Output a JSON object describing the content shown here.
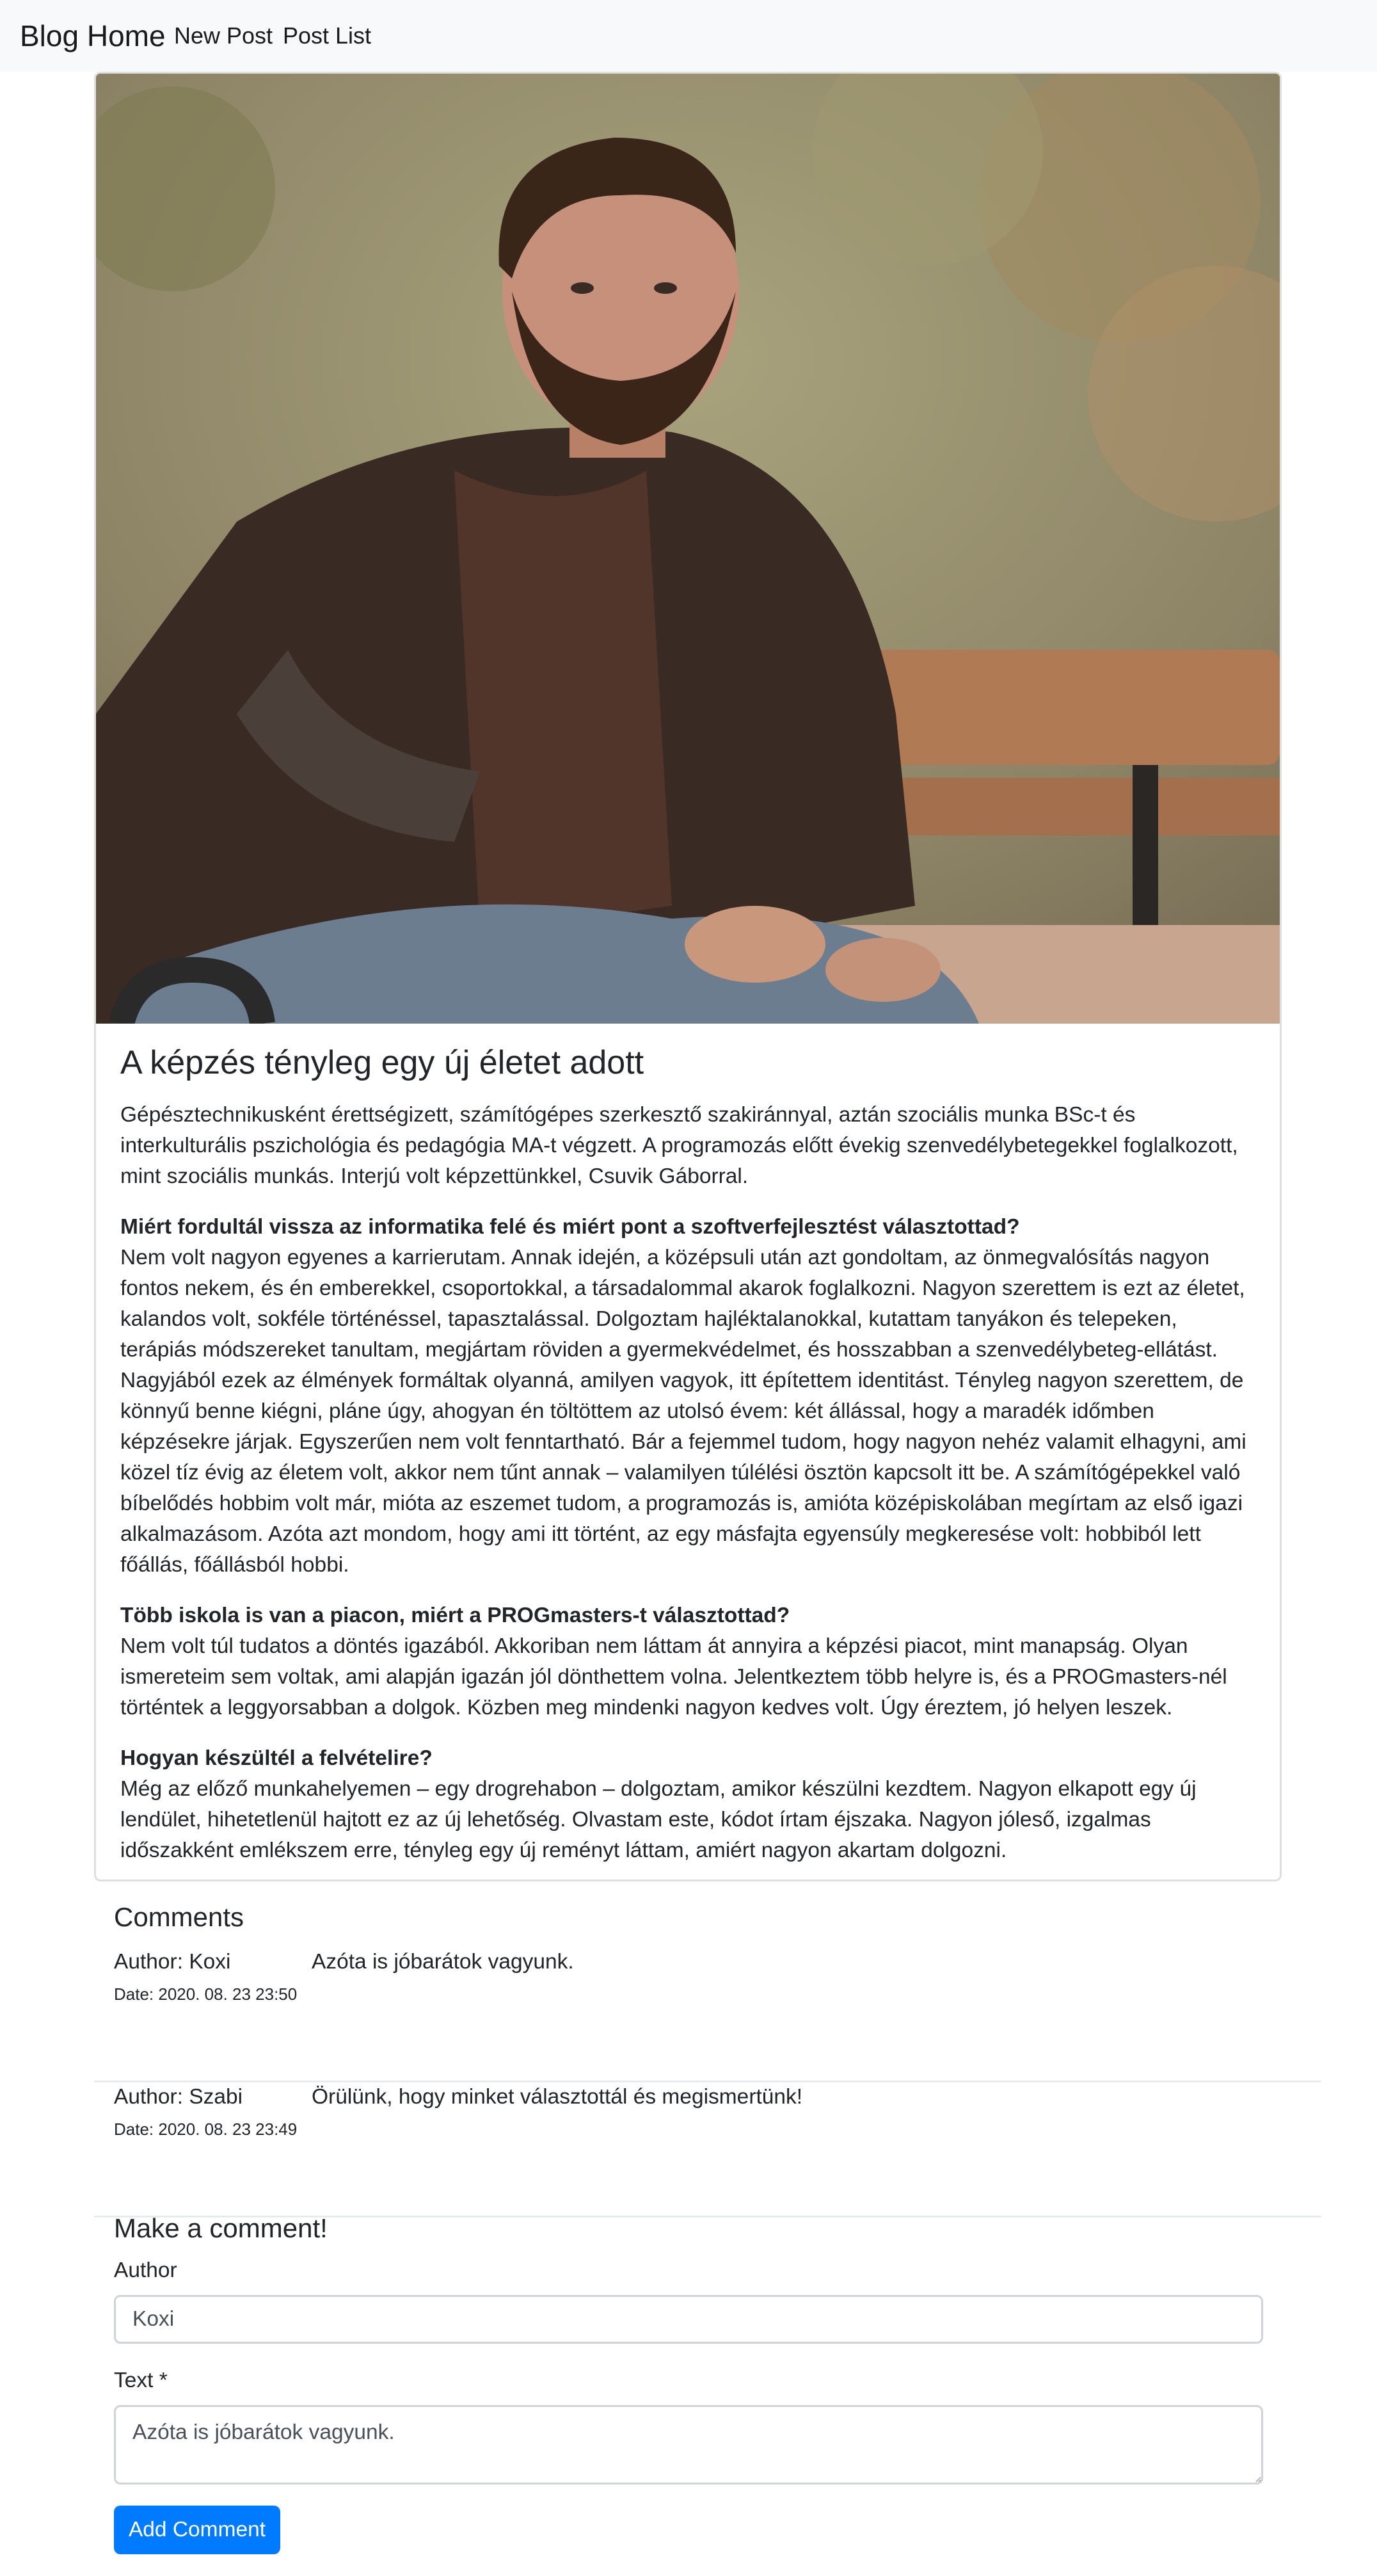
{
  "navbar": {
    "brand": "Blog Home",
    "links": [
      "New Post",
      "Post List"
    ]
  },
  "post": {
    "image_alt": "Portrait of a bearded man sitting on a park bench",
    "title": "A képzés tényleg egy új életet adott",
    "intro": "Gépésztechnikusként érettségizett, számítógépes szerkesztő szakiránnyal, aztán szociális munka BSc-t és interkulturális pszichológia és pedagógia MA-t végzett. A programozás előtt évekig szenvedélybetegekkel foglalkozott, mint szociális munkás. Interjú volt képzettünkkel, Csuvik Gáborral.",
    "sections": [
      {
        "question": "Miért fordultál vissza az informatika felé és miért pont a szoftverfejlesztést választottad?",
        "answer": "Nem volt nagyon egyenes a karrierutam. Annak idején, a középsuli után azt gondoltam, az önmegvalósítás nagyon fontos nekem, és én emberekkel, csoportokkal, a társadalommal akarok foglalkozni. Nagyon szerettem is ezt az életet, kalandos volt, sokféle történéssel, tapasztalással. Dolgoztam hajléktalanokkal, kutattam tanyákon és telepeken, terápiás módszereket tanultam, megjártam röviden a gyermekvédelmet, és hosszabban a szenvedélybeteg-ellátást. Nagyjából ezek az élmények formáltak olyanná, amilyen vagyok, itt építettem identitást. Tényleg nagyon szerettem, de könnyű benne kiégni, pláne úgy, ahogyan én töltöttem az utolsó évem: két állással, hogy a maradék időmben képzésekre járjak. Egyszerűen nem volt fenntartható. Bár a fejemmel tudom, hogy nagyon nehéz valamit elhagyni, ami közel tíz évig az életem volt, akkor nem tűnt annak – valamilyen túlélési ösztön kapcsolt itt be. A számítógépekkel való bíbelődés hobbim volt már, mióta az eszemet tudom, a programozás is, amióta középiskolában megírtam az első igazi alkalmazásom. Azóta azt mondom, hogy ami itt történt, az egy másfajta egyensúly megkeresése volt: hobbiból lett főállás, főállásból hobbi."
      },
      {
        "question": "Több iskola is van a piacon, miért a PROGmasters-t választottad?",
        "answer": "Nem volt túl tudatos a döntés igazából. Akkoriban nem láttam át annyira a képzési piacot, mint manapság. Olyan ismereteim sem voltak, ami alapján igazán jól dönthettem volna. Jelentkeztem több helyre is, és a PROGmasters-nél történtek a leggyorsabban a dolgok. Közben meg mindenki nagyon kedves volt. Úgy éreztem, jó helyen leszek."
      },
      {
        "question": "Hogyan készültél a felvételire?",
        "answer": "Még az előző munkahelyemen – egy drogrehabon – dolgoztam, amikor készülni kezdtem. Nagyon elkapott egy új lendület, hihetetlenül hajtott ez az új lehetőség. Olvastam este, kódot írtam éjszaka. Nagyon jóleső, izgalmas időszakként emlékszem erre, tényleg egy új reményt láttam, amiért nagyon akartam dolgozni."
      }
    ]
  },
  "comments": {
    "title": "Comments",
    "items": [
      {
        "author": "Author: Koxi",
        "date": "Date: 2020. 08. 23 23:50",
        "text": "Azóta is jóbarátok vagyunk."
      },
      {
        "author": "Author: Szabi",
        "date": "Date: 2020. 08. 23 23:49",
        "text": "Örülünk, hogy minket választottál és megismertünk!"
      }
    ]
  },
  "form": {
    "title": "Make a comment!",
    "author_label": "Author",
    "author_value": "Koxi",
    "text_label": "Text *",
    "text_value": "Azóta is jóbarátok vagyunk.",
    "submit_label": "Add Comment"
  },
  "colors": {
    "navbar_bg": "#f8f9fa",
    "primary": "#007bff",
    "border": "#dfdfdf"
  }
}
